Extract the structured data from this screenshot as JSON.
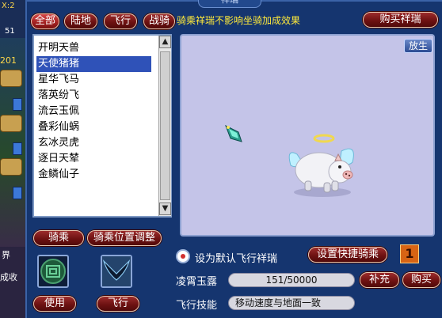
{
  "window": {
    "title": "祥瑞"
  },
  "strip": {
    "top_text_1": "X:2",
    "top_text_2": "51",
    "mid_text": "201",
    "bottom_text_1": "界",
    "bottom_text_2": "成收"
  },
  "filters": [
    "全部",
    "陆地",
    "飞行",
    "战骑"
  ],
  "notice": "骑乘祥瑞不影响坐骑加成效果",
  "buy_button": "购买祥瑞",
  "mount_list": [
    "开明天兽",
    "天使猪猪",
    "星华飞马",
    "落英纷飞",
    "流云玉佩",
    "叠彩仙蜗",
    "玄冰灵虎",
    "逐日天辇",
    "金鳞仙子"
  ],
  "selected_index": 1,
  "preview": {
    "release_button": "放生"
  },
  "actions": {
    "ride": "骑乘",
    "adjust": "骑乘位置调整",
    "use": "使用",
    "fly": "飞行"
  },
  "default_fly": {
    "label": "设为默认飞行祥瑞",
    "checked": true
  },
  "shortcut_button": "设置快捷骑乘",
  "shortcut_number": "1",
  "dew": {
    "label": "凌霄玉露",
    "value": "151/50000",
    "refill": "补充",
    "buy": "购买"
  },
  "skill": {
    "label": "飞行技能",
    "value": "移动速度与地面一致"
  },
  "colors": {
    "notice": "#ffea3a",
    "button": "#7a1818",
    "selected_row": "#2f52b8",
    "preview_bg": "#c4c4e8"
  },
  "icons": {
    "ride_slot": "jade-token-icon",
    "fly_slot": "wings-icon",
    "preview_extra": "spark-gem-icon",
    "mount": "angel-pig-icon"
  }
}
